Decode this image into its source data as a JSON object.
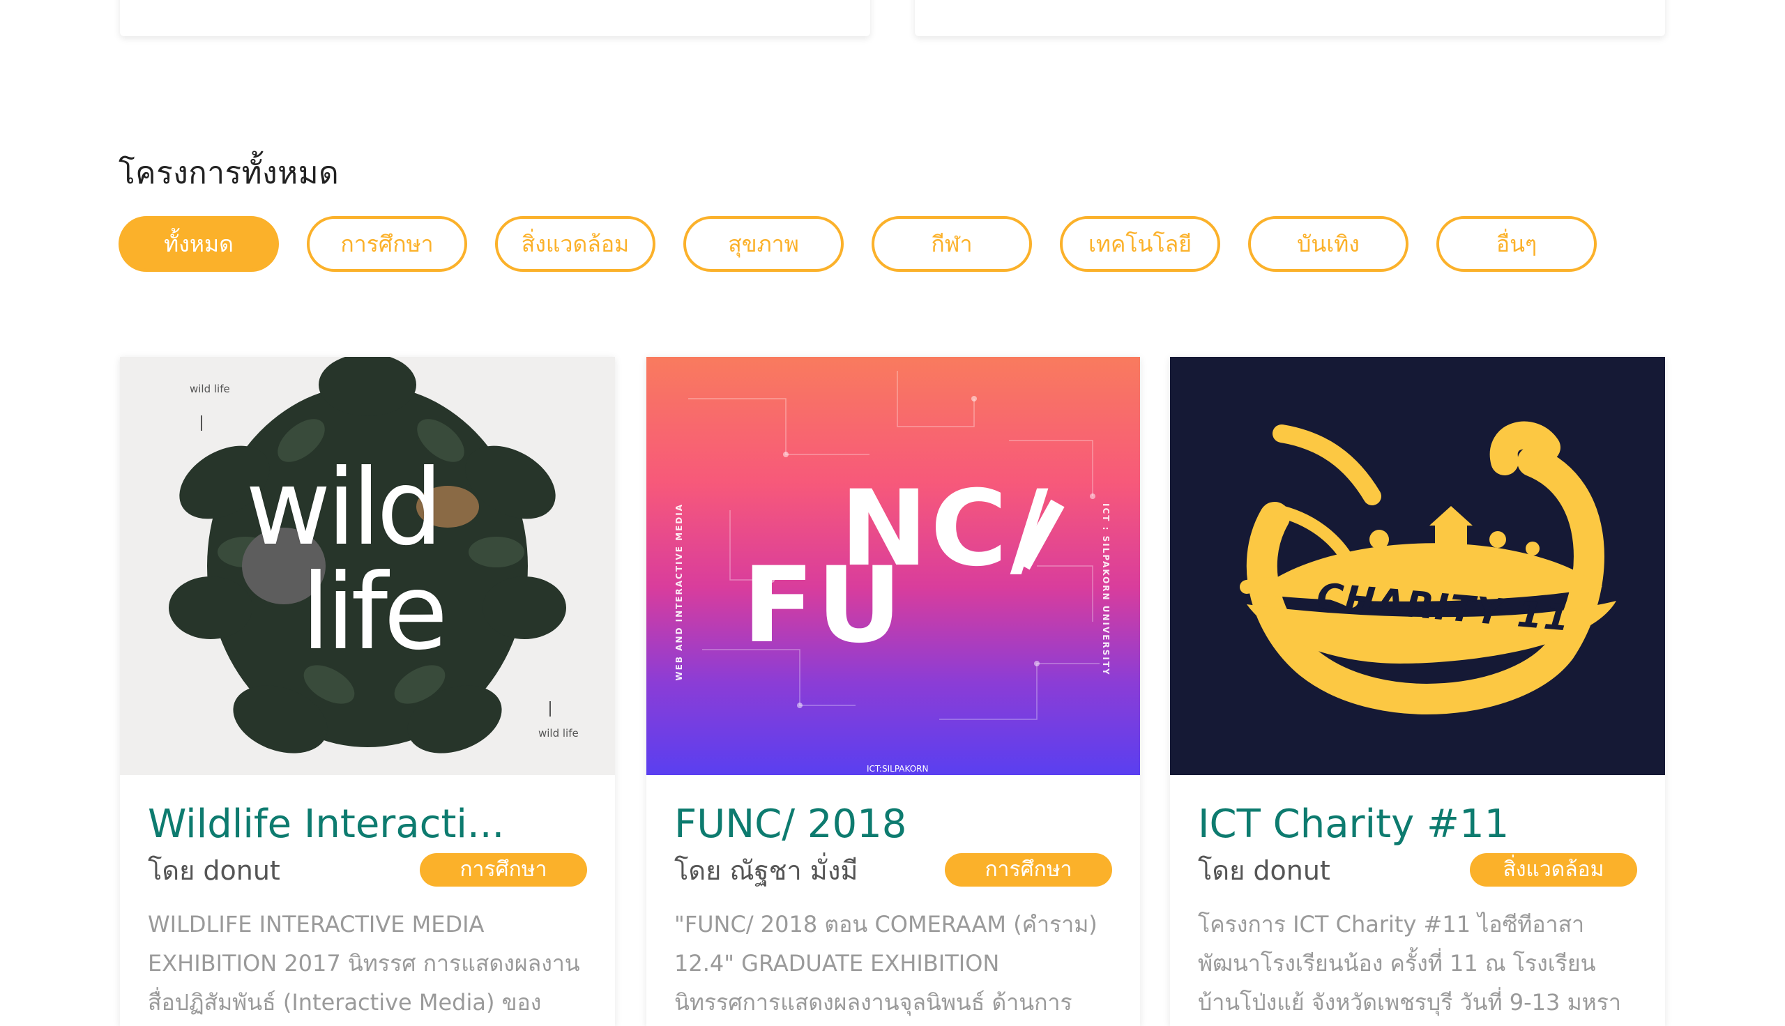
{
  "section": {
    "title": "โครงการทั้งหมด"
  },
  "filters": [
    {
      "label": "ทั้งหมด",
      "active": true
    },
    {
      "label": "การศึกษา",
      "active": false
    },
    {
      "label": "สิ่งแวดล้อม",
      "active": false
    },
    {
      "label": "สุขภาพ",
      "active": false
    },
    {
      "label": "กีฬา",
      "active": false
    },
    {
      "label": "เทคโนโลยี",
      "active": false
    },
    {
      "label": "บันเทิง",
      "active": false
    },
    {
      "label": "อื่นๆ",
      "active": false
    }
  ],
  "projects": [
    {
      "title": "Wildlife Interacti...",
      "by_label": "โดย",
      "author": "donut",
      "category": "การศึกษา",
      "description": "WILDLIFE INTERACTIVE MEDIA EXHIBITION 2017 นิทรรศ การแสดงผลงานสื่อปฏิสัมพันธ์ (Interactive Media) ของ",
      "image": {
        "small_text": "wild life",
        "big_line1": "wild",
        "big_line2": "life"
      }
    },
    {
      "title": "FUNC/ 2018",
      "by_label": "โดย",
      "author": "ณัฐชา มั่งมี",
      "category": "การศึกษา",
      "description": "\"FUNC/ 2018 ตอน COMERAAM (คำราม) 12.4\" GRADUATE EXHIBITION นิทรรศการแสดงผลงานจุลนิพนธ์ ด้านการออกแบบและ",
      "image": {
        "word_top": "NC/",
        "word_bottom": "FU",
        "side_left": "WEB AND INTERACTIVE MEDIA",
        "side_right": "ICT : SILPAKORN UNIVERSITY",
        "footer": "ICT:SILPAKORN"
      }
    },
    {
      "title": "ICT Charity #11",
      "by_label": "โดย",
      "author": "donut",
      "category": "สิ่งแวดล้อม",
      "description": "โครงการ ICT Charity #11 ไอซีทีอาสาพัฒนาโรงเรียนน้อง ครั้งที่ 11 ณ โรงเรียนบ้านโป่งแย้ จังหวัดเพชรบุรี วันที่ 9-13 มหรา",
      "image": {
        "logo_text": "CHARITY 11"
      }
    }
  ],
  "colors": {
    "accent": "#fbb12a",
    "title": "#0d7b6f",
    "muted": "#9a9a9a",
    "charity_bg": "#151935"
  }
}
